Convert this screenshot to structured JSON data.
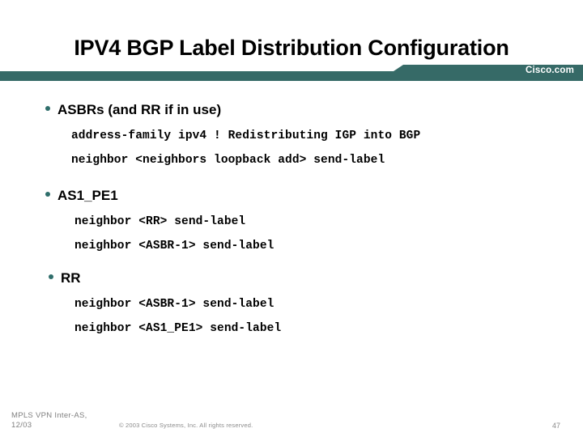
{
  "slide": {
    "title": "IPV4 BGP Label Distribution Configuration",
    "brand": "Cisco.com",
    "accent_color": "#366a67",
    "bullet_color": "#2f6e6b",
    "background_color": "#ffffff",
    "title_color": "#000000",
    "footer_color": "#8a8a8a"
  },
  "sections": [
    {
      "bullet": "ASBRs (and RR if in use)",
      "lines": [
        "address-family ipv4 ! Redistributing IGP into BGP",
        "neighbor <neighbors loopback add> send-label"
      ]
    },
    {
      "bullet": "AS1_PE1",
      "lines": [
        "neighbor <RR> send-label",
        "neighbor <ASBR-1> send-label"
      ]
    },
    {
      "bullet": "RR",
      "lines": [
        "neighbor <ASBR-1> send-label",
        "neighbor <AS1_PE1> send-label"
      ]
    }
  ],
  "footer": {
    "deck_title": "MPLS VPN Inter-AS,",
    "deck_date": "12/03",
    "copyright": "© 2003 Cisco Systems, Inc. All rights reserved.",
    "page_number": "47"
  }
}
